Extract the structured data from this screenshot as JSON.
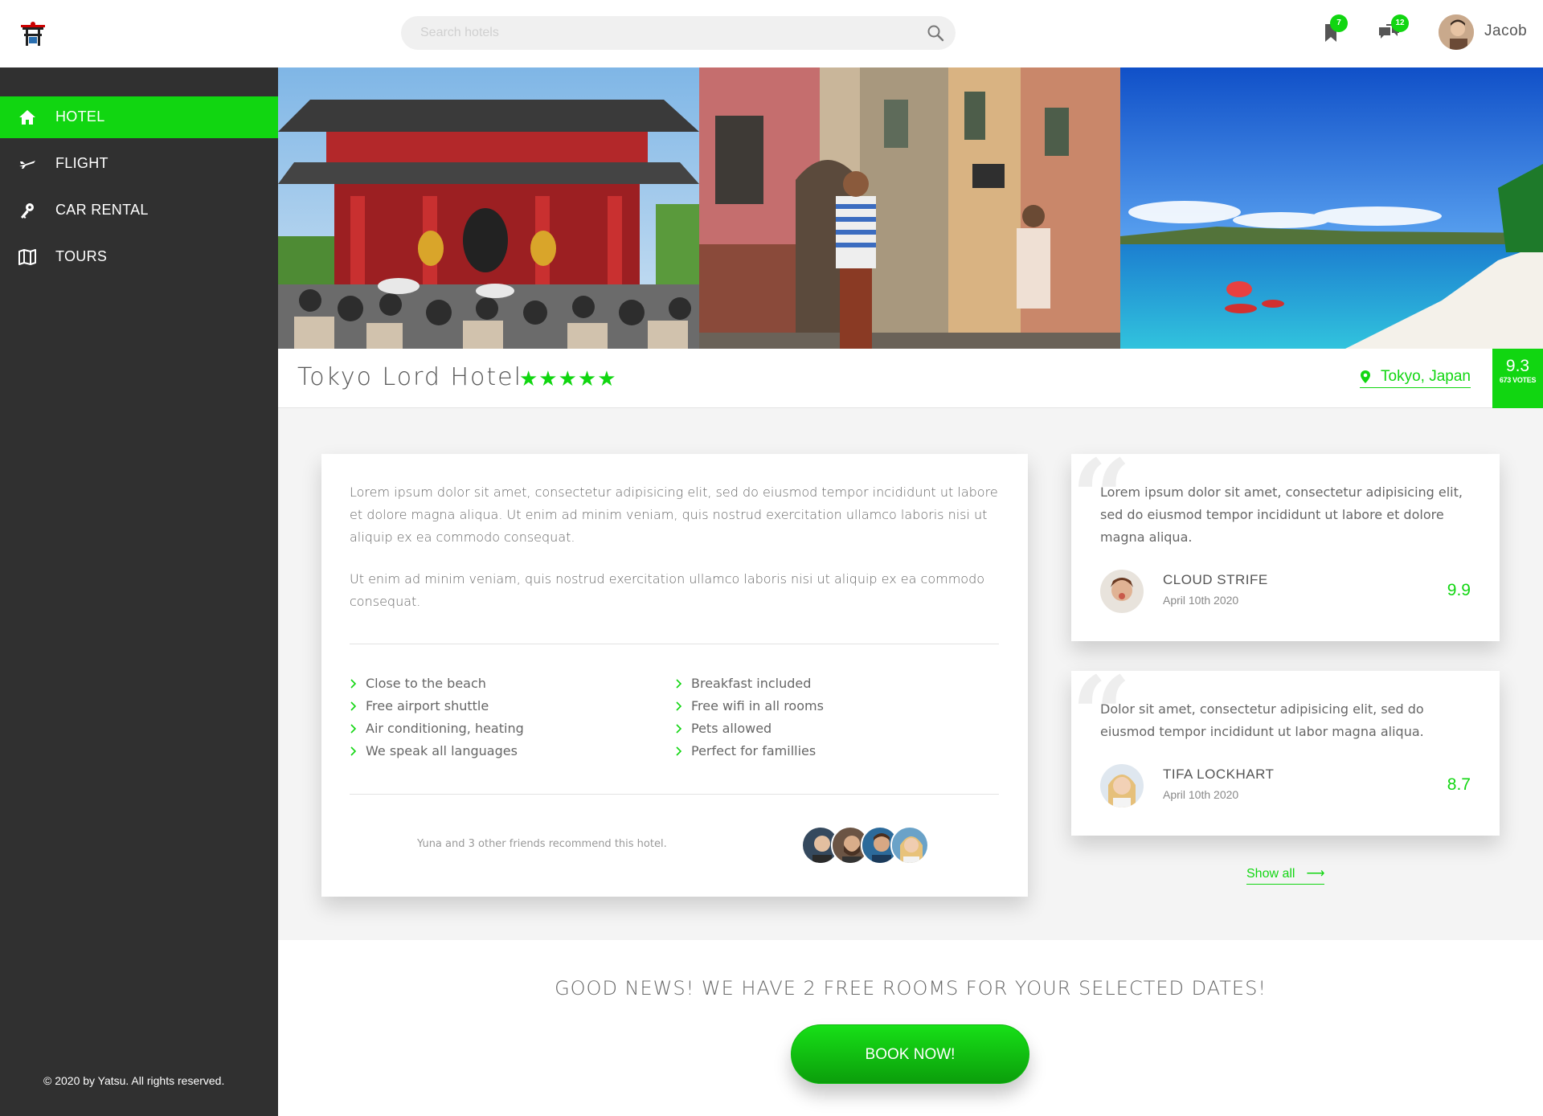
{
  "header": {
    "search_placeholder": "Search hotels",
    "bookmarks_badge": "7",
    "messages_badge": "12",
    "user_name": "Jacob"
  },
  "sidebar": {
    "items": [
      {
        "label": "HOTEL",
        "icon": "home-icon",
        "active": true
      },
      {
        "label": "FLIGHT",
        "icon": "plane-icon",
        "active": false
      },
      {
        "label": "CAR RENTAL",
        "icon": "key-icon",
        "active": false
      },
      {
        "label": "TOURS",
        "icon": "map-icon",
        "active": false
      }
    ],
    "footer": "© 2020 by Yatsu. All rights reserved."
  },
  "hotel": {
    "name": "Tokyo Lord Hotel",
    "stars": "★★★★★",
    "location": "Tokyo, Japan",
    "score": "9.3",
    "votes": "673 VOTES"
  },
  "description": {
    "paragraph1": "Lorem ipsum dolor sit amet, consectetur adipisicing elit, sed do eiusmod tempor incididunt ut labore et dolore magna aliqua. Ut enim ad minim veniam, quis nostrud exercitation ullamco laboris nisi ut aliquip ex ea commodo consequat.",
    "paragraph2": "Ut enim ad minim veniam, quis nostrud exercitation ullamco laboris nisi ut aliquip ex ea commodo consequat.",
    "features_left": [
      "Close to the beach",
      "Free airport shuttle",
      "Air conditioning, heating",
      "We speak all languages"
    ],
    "features_right": [
      "Breakfast included",
      "Free wifi in all rooms",
      "Pets allowed",
      "Perfect for famillies"
    ],
    "friends_text": "Yuna and 3 other friends recommend this hotel."
  },
  "reviews": [
    {
      "text": "Lorem ipsum dolor sit amet, consectetur adipisicing elit, sed do eiusmod tempor incididunt ut labore et dolore magna aliqua.",
      "name": "CLOUD STRIFE",
      "date": "April 10th 2020",
      "score": "9.9"
    },
    {
      "text": "Dolor sit amet, consectetur adipisicing elit, sed do eiusmod tempor incididunt ut labor magna aliqua.",
      "name": "TIFA LOCKHART",
      "date": "April 10th 2020",
      "score": "8.7"
    }
  ],
  "show_all": "Show all",
  "availability": {
    "message": "GOOD NEWS! WE HAVE 2 FREE ROOMS FOR YOUR SELECTED DATES!",
    "cta": "BOOK NOW!"
  },
  "colors": {
    "accent": "#11d611",
    "sidebar": "#303030"
  }
}
